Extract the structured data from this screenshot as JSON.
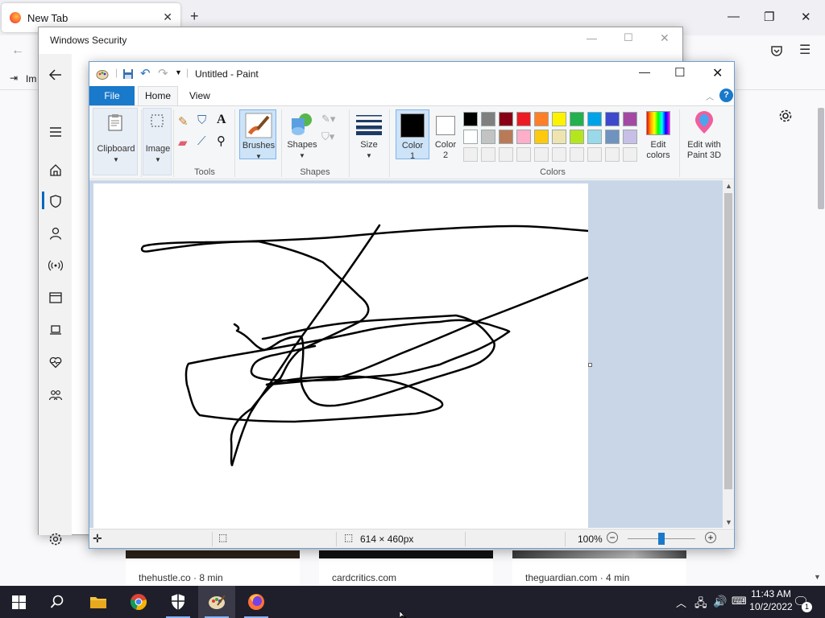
{
  "firefox": {
    "tab_title": "New Tab",
    "bookmark_label": "Im",
    "cards": [
      {
        "source": "thehustle.co · 8 min"
      },
      {
        "source": "cardcritics.com"
      },
      {
        "source": "theguardian.com · 4 min"
      }
    ]
  },
  "security": {
    "window_title": "Windows Security",
    "nav_items": [
      "back-icon",
      "menu-icon",
      "home-icon",
      "shield-icon",
      "account-icon",
      "wireless-icon",
      "app-browser-icon",
      "device-icon",
      "health-icon",
      "family-icon",
      "settings-icon"
    ]
  },
  "paint": {
    "window_title": "Untitled - Paint",
    "tabs": {
      "file": "File",
      "home": "Home",
      "view": "View"
    },
    "groups": {
      "clipboard": "Clipboard",
      "image": "Image",
      "tools": "Tools",
      "brushes": "Brushes",
      "shapes": "Shapes",
      "shapes_group": "Shapes",
      "size": "Size",
      "color1": "Color\n1",
      "color2": "Color\n2",
      "colors": "Colors",
      "edit_colors": "Edit\ncolors",
      "paint3d": "Edit with\nPaint 3D"
    },
    "palette_row1": [
      "#000000",
      "#7f7f7f",
      "#880015",
      "#ed1c24",
      "#ff7f27",
      "#fff200",
      "#22b14c",
      "#00a2e8",
      "#3f48cc",
      "#a349a4"
    ],
    "palette_row2": [
      "#ffffff",
      "#c3c3c3",
      "#b97a57",
      "#ffaec9",
      "#ffc90e",
      "#efe4b0",
      "#b5e61d",
      "#99d9ea",
      "#7092be",
      "#c8bfe7"
    ],
    "palette_row3": [
      "#f0f0f0",
      "#f0f0f0",
      "#f0f0f0",
      "#f0f0f0",
      "#f0f0f0",
      "#f0f0f0",
      "#f0f0f0",
      "#f0f0f0",
      "#f0f0f0",
      "#f0f0f0"
    ],
    "color1": "#000000",
    "color2": "#ffffff",
    "status": {
      "size": "614 × 460px",
      "zoom": "100%"
    }
  },
  "taskbar": {
    "time": "11:43 AM",
    "date": "10/2/2022",
    "notification_count": "1"
  }
}
